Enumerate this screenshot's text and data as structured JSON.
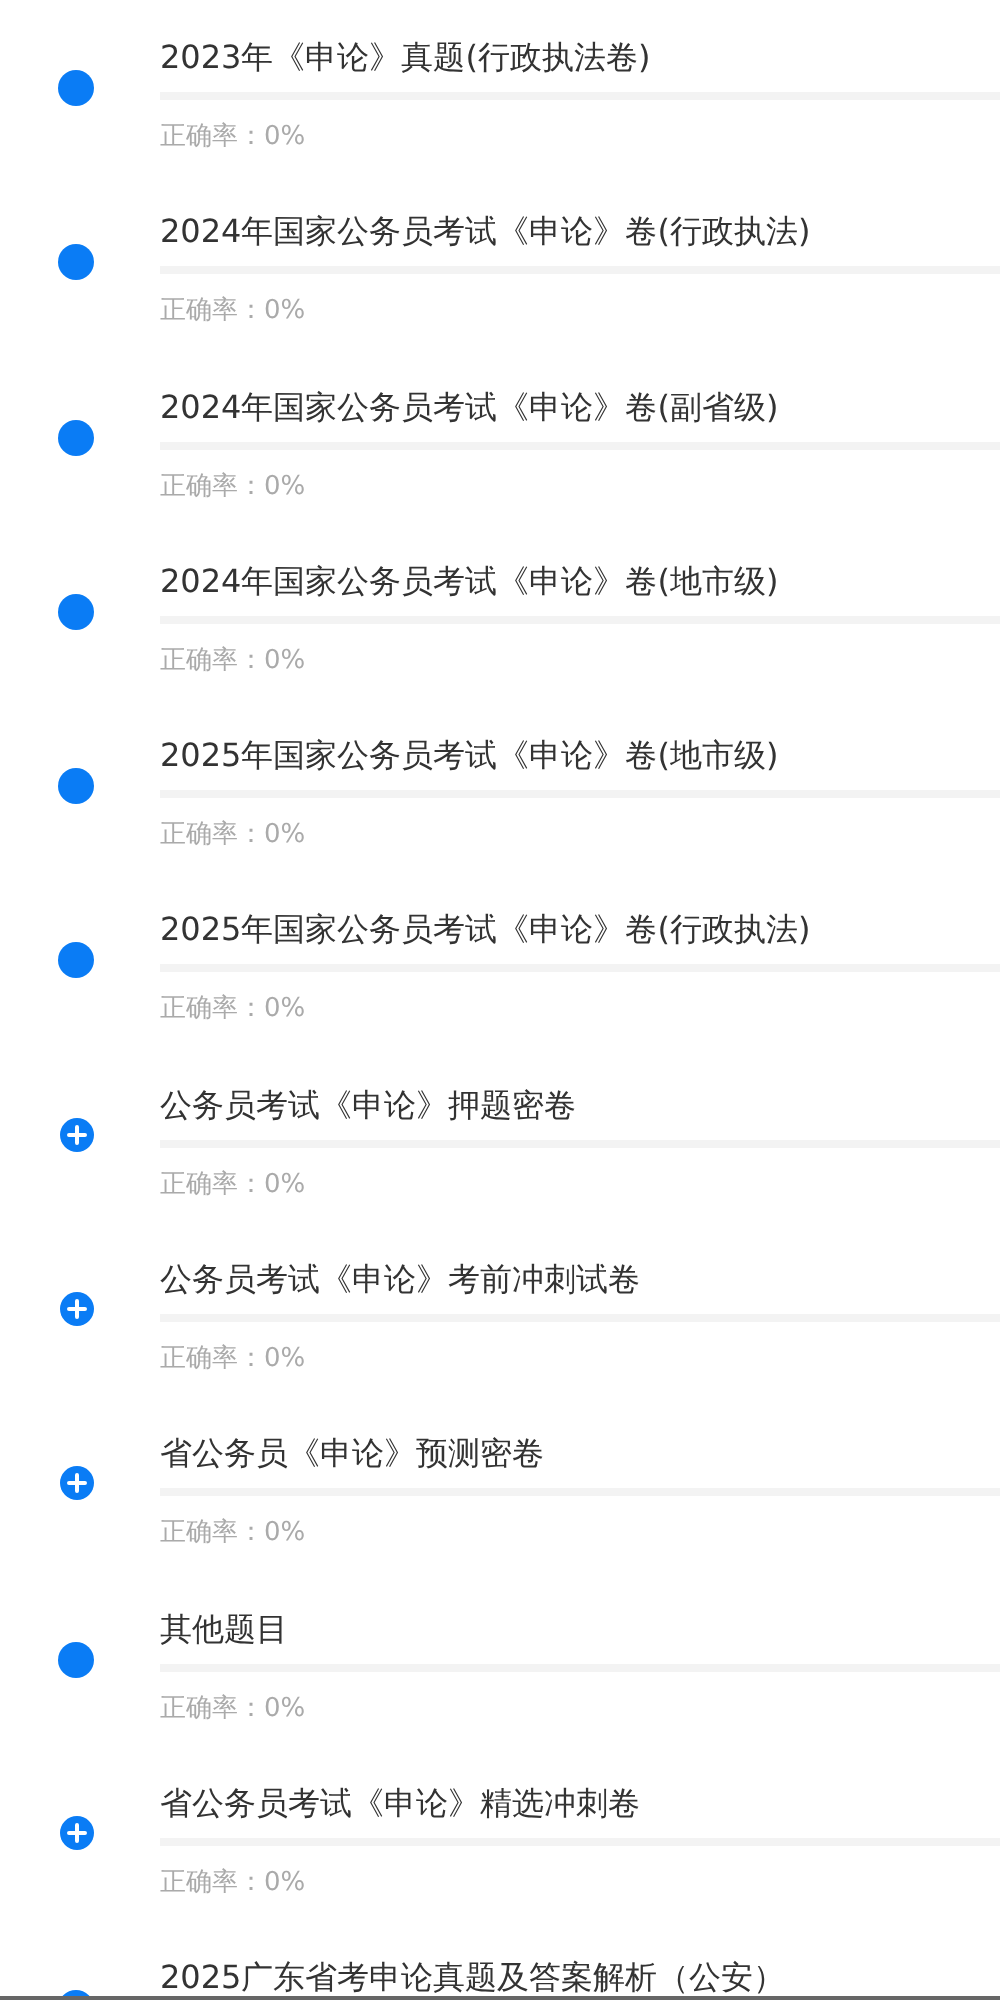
{
  "papers": [
    {
      "kind": "dot",
      "title": "2023年《申论》真题(行政执法卷)",
      "level": 0,
      "accuracy": "正确率：0%"
    },
    {
      "kind": "dot",
      "title": "2024年国家公务员考试《申论》卷(行政执法)",
      "level": 0,
      "accuracy": "正确率：0%"
    },
    {
      "kind": "dot",
      "title": "2024年国家公务员考试《申论》卷(副省级)",
      "level": 0,
      "accuracy": "正确率：0%"
    },
    {
      "kind": "dot",
      "title": "2024年国家公务员考试《申论》卷(地市级)",
      "level": 0,
      "accuracy": "正确率：0%"
    },
    {
      "kind": "dot",
      "title": "2025年国家公务员考试《申论》卷(地市级)",
      "level": 0,
      "accuracy": "正确率：0%"
    },
    {
      "kind": "dot",
      "title": "2025年国家公务员考试《申论》卷(行政执法)",
      "level": 0,
      "accuracy": "正确率：0%"
    },
    {
      "kind": "expand",
      "title": "公务员考试《申论》押题密卷",
      "level": 0,
      "accuracy": "正确率：0%"
    },
    {
      "kind": "expand",
      "title": "公务员考试《申论》考前冲刺试卷",
      "level": 0,
      "accuracy": "正确率：0%"
    },
    {
      "kind": "expand",
      "title": "省公务员《申论》预测密卷",
      "level": 0,
      "accuracy": "正确率：0%"
    },
    {
      "kind": "dot",
      "title": "其他题目",
      "level": 0,
      "accuracy": "正确率：0%"
    },
    {
      "kind": "expand",
      "title": "省公务员考试《申论》精选冲刺卷",
      "level": 0,
      "accuracy": "正确率：0%"
    },
    {
      "kind": "dot",
      "title": "2025广东省考申论真题及答案解析（公安）"
    }
  ]
}
